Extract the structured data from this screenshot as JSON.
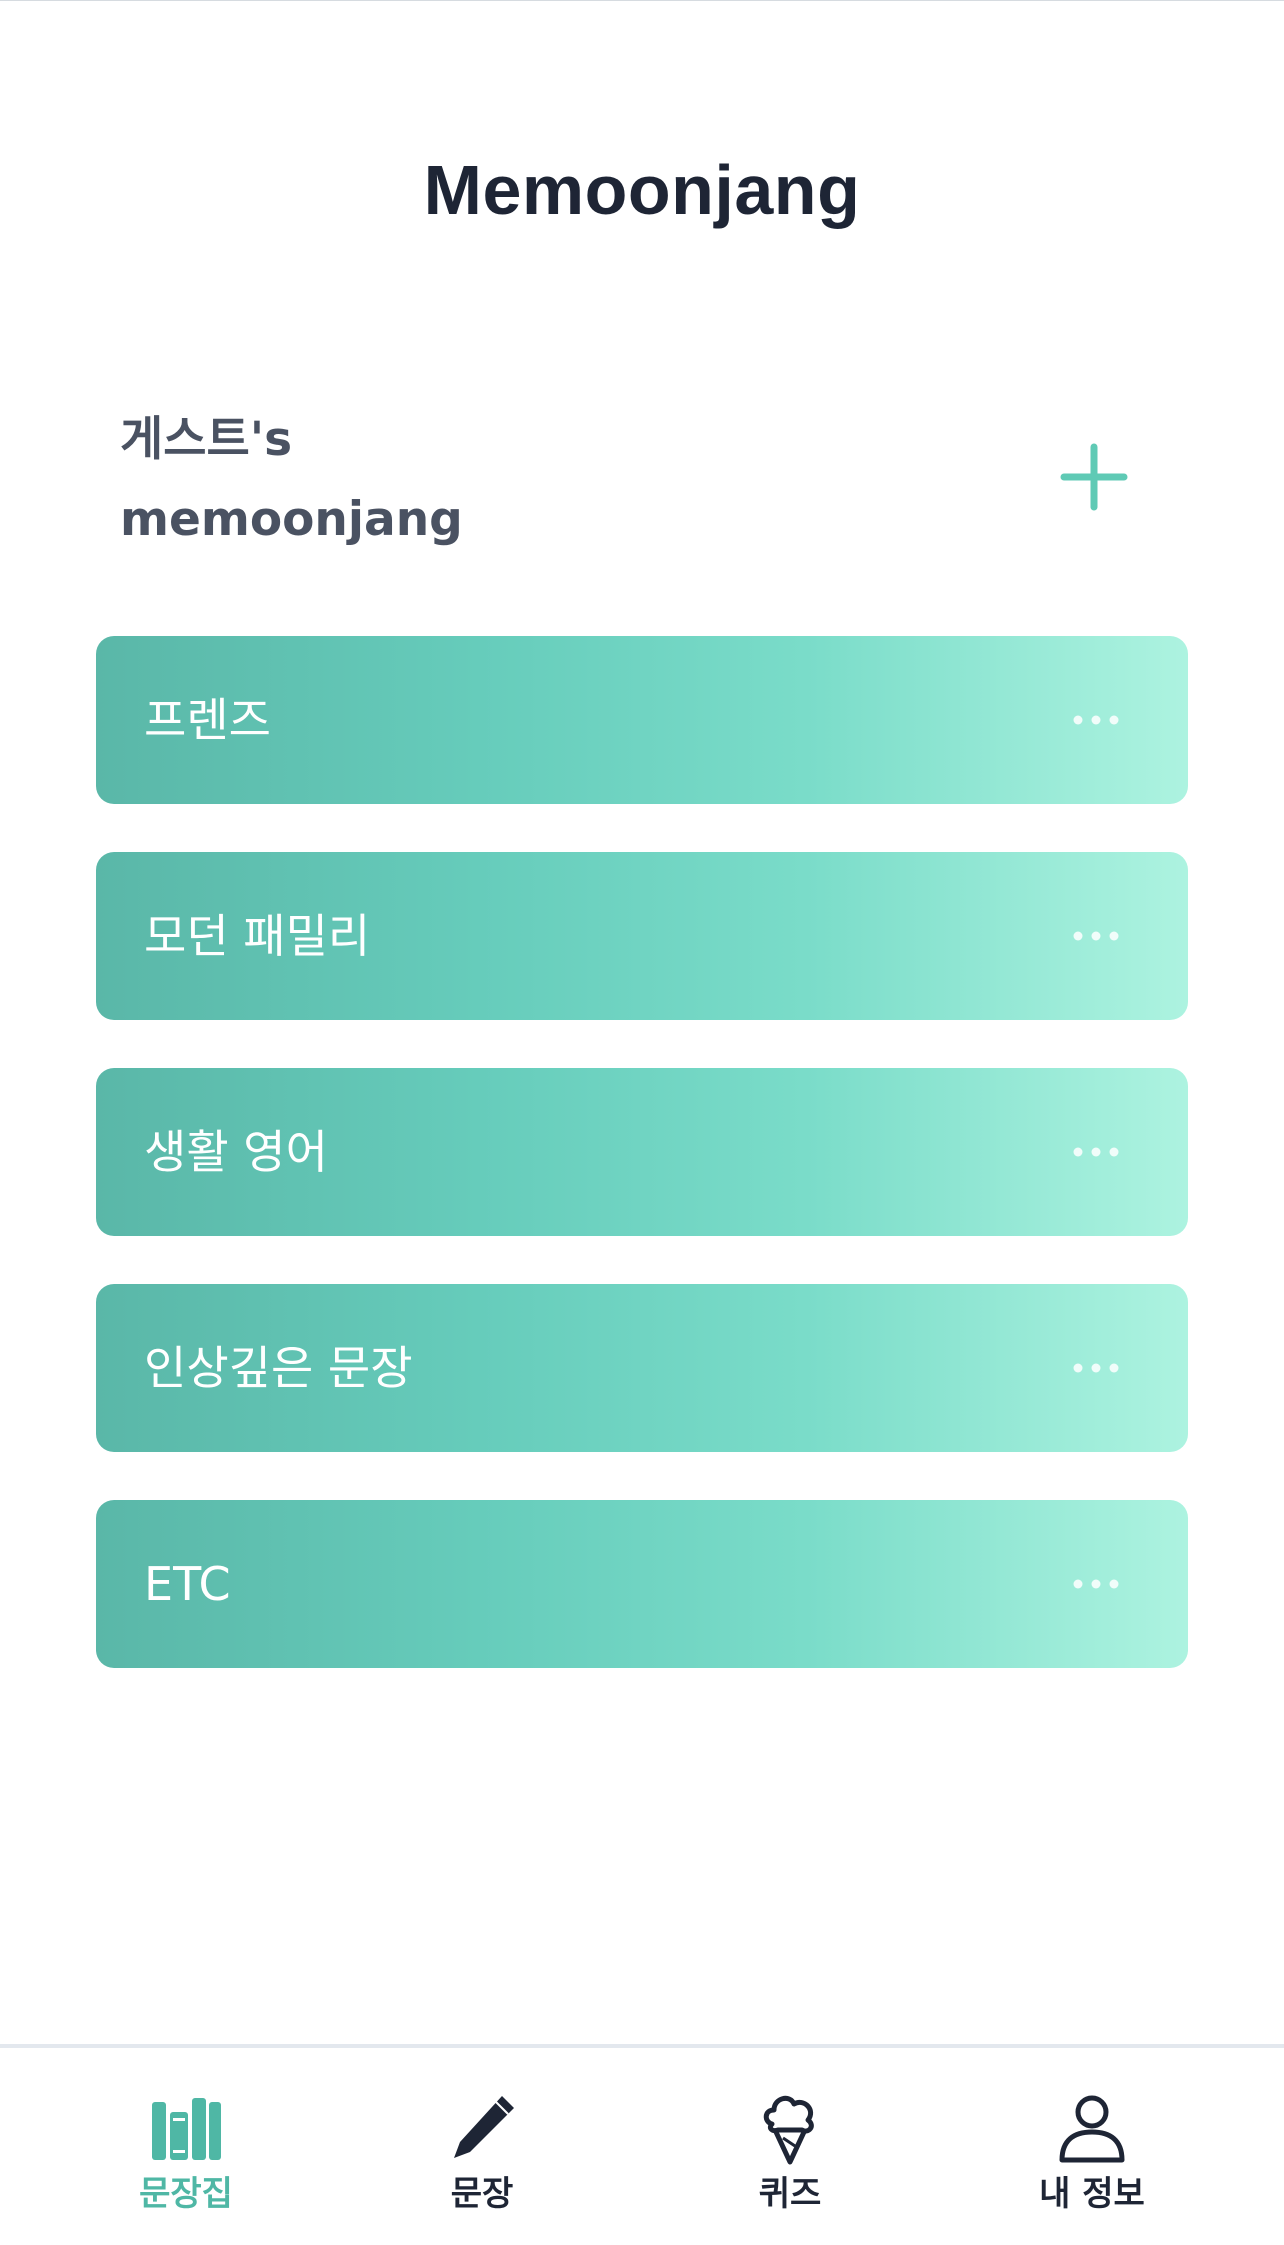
{
  "app": {
    "title": "Memoonjang"
  },
  "owner": {
    "line1": "게스트's",
    "line2": "memoonjang"
  },
  "icons": {
    "add": "plus-icon",
    "more": "more-horizontal-icon"
  },
  "colors": {
    "accent": "#4fb7a5",
    "card_gradient_start": "#5ab7a8",
    "card_gradient_end": "#adf3e0",
    "title": "#1e2535"
  },
  "collections": [
    {
      "label": "프렌즈"
    },
    {
      "label": "모던 패밀리"
    },
    {
      "label": "생활 영어"
    },
    {
      "label": "인상깊은 문장"
    },
    {
      "label": "ETC"
    }
  ],
  "tabs": [
    {
      "label": "문장집",
      "icon": "books-icon",
      "active": true
    },
    {
      "label": "문장",
      "icon": "pencil-icon",
      "active": false
    },
    {
      "label": "퀴즈",
      "icon": "ice-cream-icon",
      "active": false
    },
    {
      "label": "내 정보",
      "icon": "user-icon",
      "active": false
    }
  ]
}
